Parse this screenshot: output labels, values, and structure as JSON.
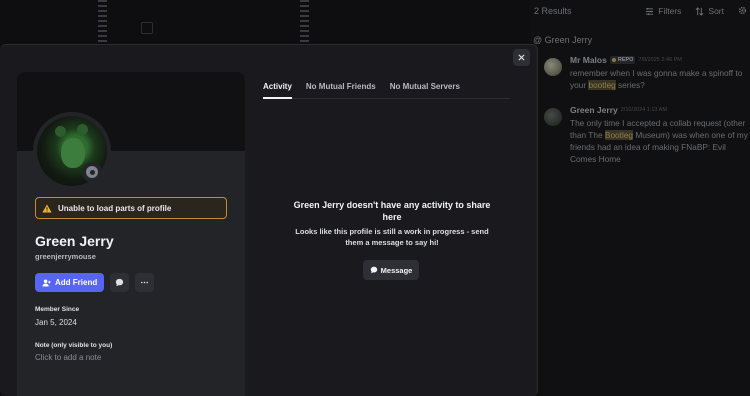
{
  "search": {
    "results_count": "2 Results",
    "filters_label": "Filters",
    "sort_label": "Sort",
    "channel_label": "@ Green Jerry",
    "messages": [
      {
        "author": "Mr Malos",
        "tag": "REPO",
        "time": "7/8/2025 2:46 PM",
        "text_before": "remember when I was gonna make a spinoff to your ",
        "highlight": "bootleg",
        "text_after": " series?"
      },
      {
        "author": "Green Jerry",
        "time": "2/10/2024 1:13 AM",
        "text_before": "The only time I accepted a collab request (other than The ",
        "highlight": "Bootleg",
        "text_after": " Museum) was when one of my friends had an idea of making FNaBP: Evil Comes Home"
      }
    ]
  },
  "profile": {
    "warning": "Unable to load parts of profile",
    "display_name": "Green Jerry",
    "username": "greenjerrymouse",
    "add_friend_label": "Add Friend",
    "member_since_label": "Member Since",
    "member_since_value": "Jan 5, 2024",
    "note_label": "Note (only visible to you)",
    "note_placeholder": "Click to add a note"
  },
  "tabs": [
    "Activity",
    "No Mutual Friends",
    "No Mutual Servers"
  ],
  "activity": {
    "empty_title": "Green Jerry doesn't have any activity to share here",
    "empty_subtitle": "Looks like this profile is still a work in progress - send them a message to say hi!",
    "message_button": "Message"
  },
  "colors": {
    "accent": "#5865f2",
    "warning_border": "#c88a2b",
    "modal_bg": "#1a1a1e",
    "panel_bg": "#232428"
  }
}
